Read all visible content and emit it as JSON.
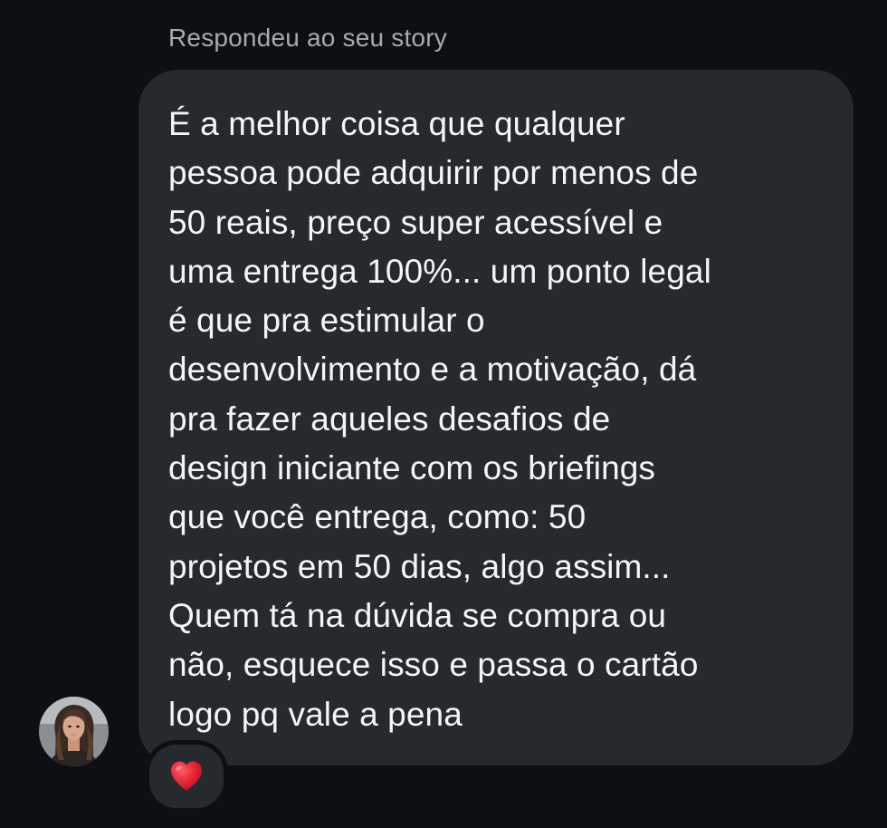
{
  "reply_label": "Respondeu ao seu story",
  "message": {
    "lines": [
      "É a melhor coisa que qualquer",
      "pessoa pode adquirir por menos de",
      "50 reais, preço super acessível e",
      "uma entrega 100%... um ponto legal",
      "é que pra estimular o",
      "desenvolvimento e a motivação, dá",
      "pra fazer aqueles desafios de",
      "design iniciante com os briefings",
      "que você entrega, como: 50",
      "projetos em 50 dias, algo assim...",
      "Quem tá na dúvida se compra ou",
      "não, esquece isso e passa o cartão",
      "logo pq vale a pena"
    ]
  },
  "sender": {
    "avatar_icon": "user-avatar-photo"
  },
  "reaction": {
    "icon": "red-heart-icon",
    "color": "#e0202f"
  },
  "colors": {
    "background": "#0c1014",
    "bubble": "#262a2f",
    "text": "#f4f5f6",
    "muted": "#a8aaae"
  }
}
